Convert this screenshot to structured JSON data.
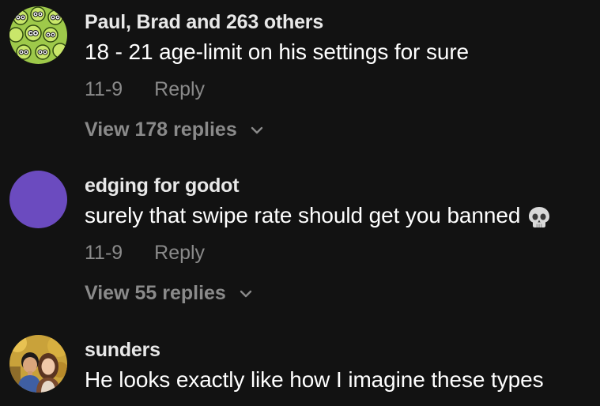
{
  "comments": [
    {
      "avatar_icon": "alien-pattern-avatar",
      "username": "Paul, Brad and 263 others",
      "text": "18 - 21 age-limit on his settings for sure",
      "date": "11-9",
      "reply_label": "Reply",
      "view_replies_label": "View 178 replies"
    },
    {
      "avatar_icon": "purple-circle-avatar",
      "avatar_color": "#6b4bbf",
      "username": "edging for godot",
      "text": "surely that swipe rate should get you banned",
      "emoji_icon": "skull-icon",
      "date": "11-9",
      "reply_label": "Reply",
      "view_replies_label": "View 55 replies"
    },
    {
      "avatar_icon": "couple-photo-avatar",
      "username": "sunders",
      "text": "He looks exactly like how I imagine these types"
    }
  ],
  "colors": {
    "background": "#121212",
    "primary_text": "#ffffff",
    "secondary_text": "#8a8a8a"
  }
}
